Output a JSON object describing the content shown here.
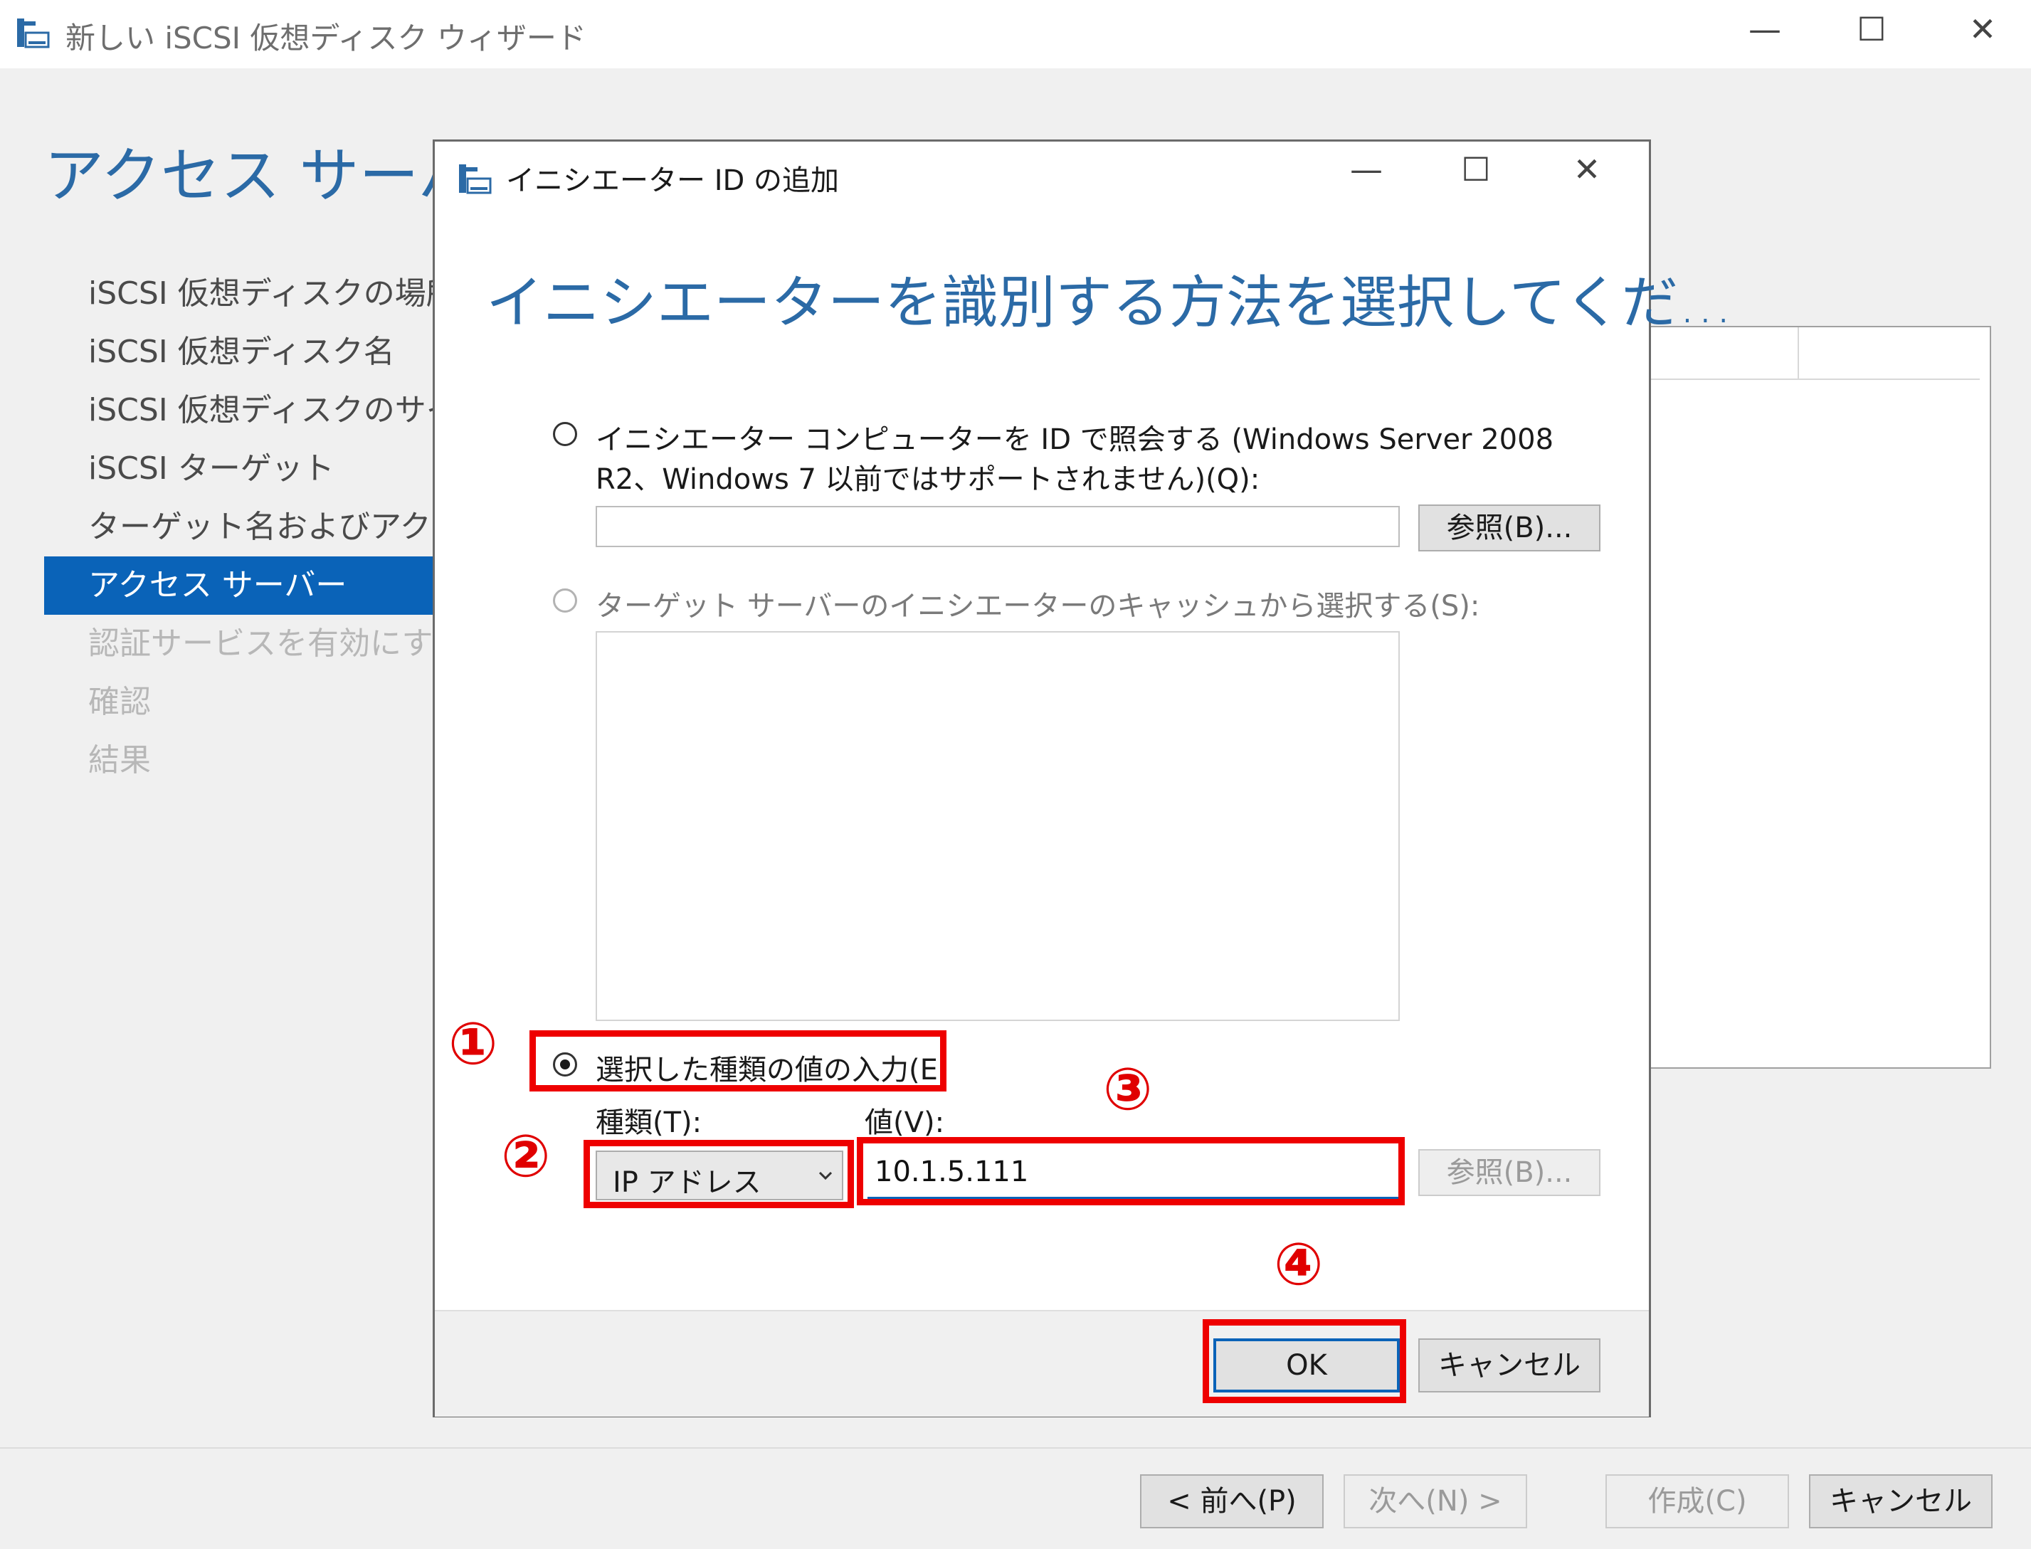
{
  "main_window": {
    "title": "新しい iSCSI 仮想ディスク ウィザード",
    "icon": "storage-drive-icon",
    "controls": {
      "minimize": "—",
      "maximize": "☐",
      "close": "✕"
    },
    "heading": "アクセス サーバーの",
    "steps": [
      {
        "label": "iSCSI 仮想ディスクの場所",
        "state": "normal"
      },
      {
        "label": "iSCSI 仮想ディスク名",
        "state": "normal"
      },
      {
        "label": "iSCSI 仮想ディスクのサイズ",
        "state": "normal"
      },
      {
        "label": "iSCSI ターゲット",
        "state": "normal"
      },
      {
        "label": "ターゲット名およびアクセス",
        "state": "normal"
      },
      {
        "label": "アクセス サーバー",
        "state": "active"
      },
      {
        "label": "認証サービスを有効にする",
        "state": "disabled"
      },
      {
        "label": "確認",
        "state": "disabled"
      },
      {
        "label": "結果",
        "state": "disabled"
      }
    ],
    "footer": {
      "prev": "< 前へ(P)",
      "next": "次へ(N) >",
      "create": "作成(C)",
      "cancel": "キャンセル"
    }
  },
  "dialog": {
    "title": "イニシエーター ID の追加",
    "icon": "storage-drive-icon",
    "controls": {
      "minimize": "—",
      "maximize": "☐",
      "close": "✕"
    },
    "heading": "イニシエーターを識別する方法を選択してくだ...",
    "option_query": {
      "line1": "イニシエーター コンピューターを ID で照会する (Windows Server 2008",
      "line2": "R2、Windows 7 以前ではサポートされません)(Q):",
      "selected": false,
      "input_value": "",
      "browse": "参照(B)..."
    },
    "option_cache": {
      "label": "ターゲット サーバーのイニシエーターのキャッシュから選択する(S):",
      "selected": false,
      "enabled": false
    },
    "option_manual": {
      "label": "選択した種類の値の入力(E)",
      "selected": true,
      "type_label": "種類(T):",
      "type_value": "IP アドレス",
      "value_label": "値(V):",
      "value": "10.1.5.111",
      "browse": "参照(B)..."
    },
    "ok": "OK",
    "cancel": "キャンセル"
  },
  "annotations": {
    "n1": "①",
    "n2": "②",
    "n3": "③",
    "n4": "④",
    "color": "#ee0000"
  }
}
